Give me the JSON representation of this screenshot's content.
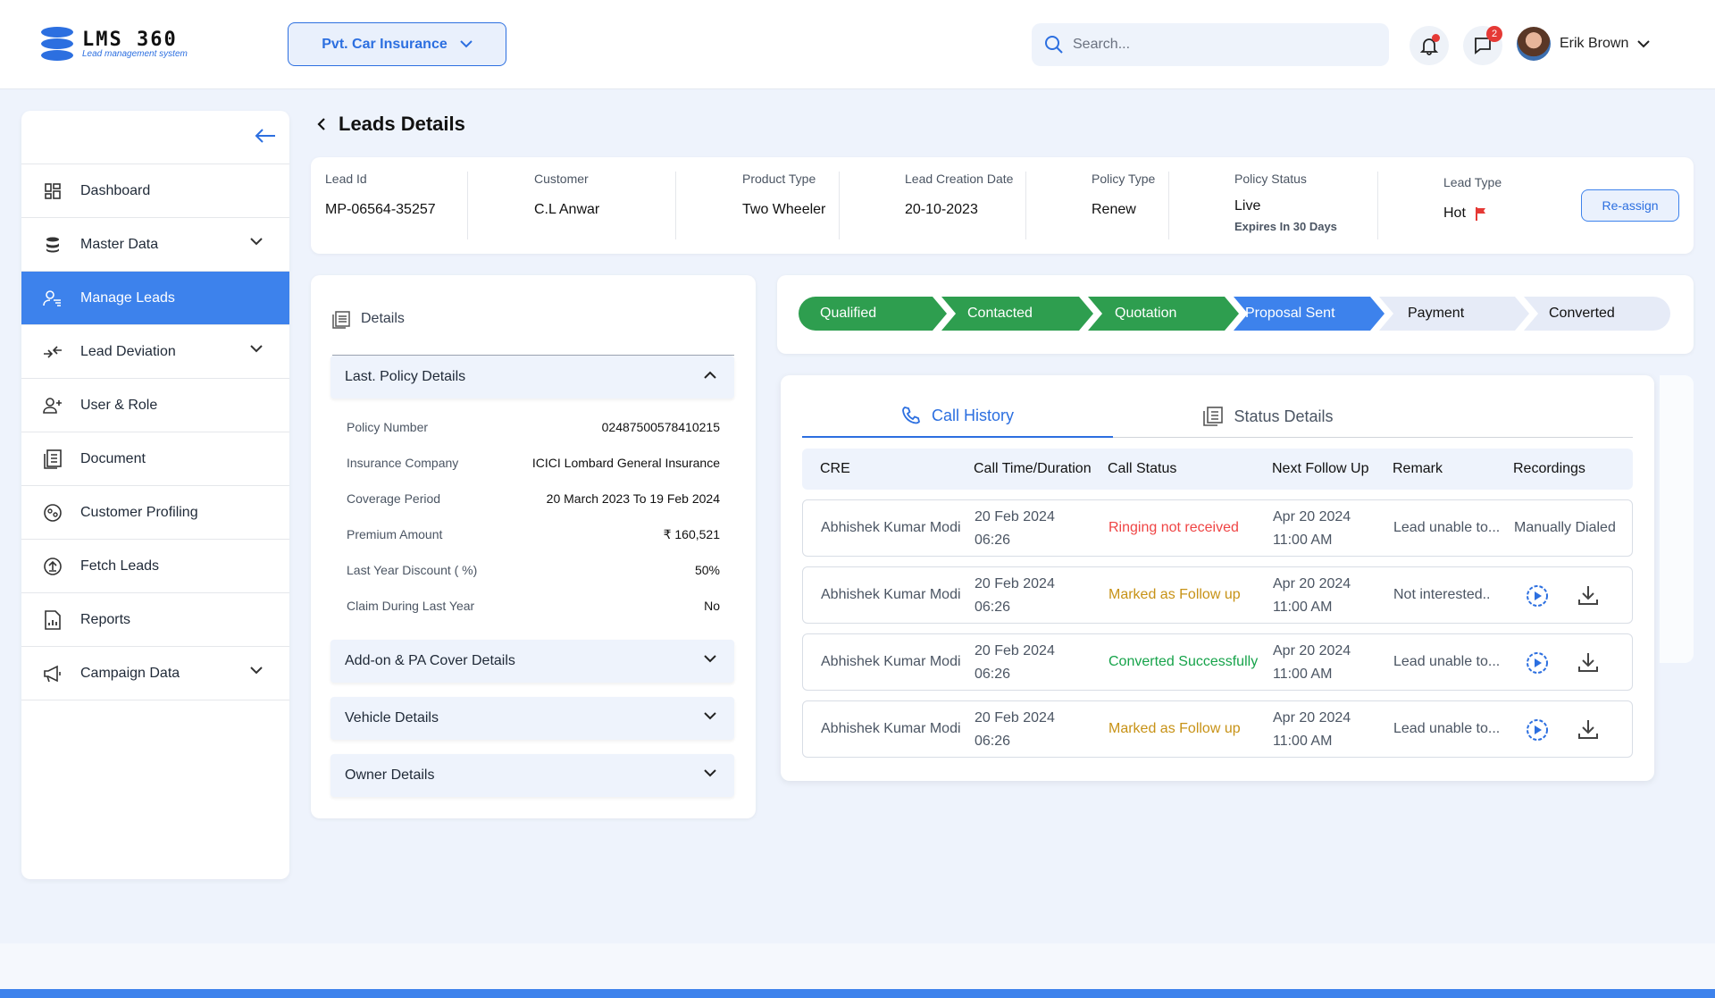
{
  "app": {
    "name": "LMS 360",
    "tagline": "Lead management system"
  },
  "header": {
    "product_select": "Pvt. Car Insurance",
    "search_placeholder": "Search...",
    "notifications_dot": true,
    "messages_count": "2",
    "user_name": "Erik Brown"
  },
  "sidebar": {
    "items": [
      {
        "label": "Dashboard",
        "icon": "dashboard-icon",
        "has_children": false,
        "active": false
      },
      {
        "label": "Master Data",
        "icon": "database-icon",
        "has_children": true,
        "active": false
      },
      {
        "label": "Manage Leads",
        "icon": "user-manage-icon",
        "has_children": false,
        "active": true
      },
      {
        "label": "Lead Deviation",
        "icon": "deviation-icon",
        "has_children": true,
        "active": false
      },
      {
        "label": "User & Role",
        "icon": "user-add-icon",
        "has_children": false,
        "active": false
      },
      {
        "label": "Document",
        "icon": "document-icon",
        "has_children": false,
        "active": false
      },
      {
        "label": "Customer Profiling",
        "icon": "profile-icon",
        "has_children": false,
        "active": false
      },
      {
        "label": "Fetch Leads",
        "icon": "fetch-icon",
        "has_children": false,
        "active": false
      },
      {
        "label": "Reports",
        "icon": "report-icon",
        "has_children": false,
        "active": false
      },
      {
        "label": "Campaign Data",
        "icon": "megaphone-icon",
        "has_children": true,
        "active": false
      }
    ]
  },
  "page": {
    "title": "Leads Details"
  },
  "lead_info": {
    "lead_id": {
      "label": "Lead Id",
      "value": "MP-06564-35257"
    },
    "customer": {
      "label": "Customer",
      "value": "C.L Anwar"
    },
    "product_type": {
      "label": "Product Type",
      "value": "Two Wheeler"
    },
    "creation_date": {
      "label": "Lead Creation Date",
      "value": "20-10-2023"
    },
    "policy_type": {
      "label": "Policy Type",
      "value": "Renew"
    },
    "policy_status": {
      "label": "Policy Status",
      "value": "Live",
      "sub": "Expires In 30 Days"
    },
    "lead_type": {
      "label": "Lead Type",
      "value": "Hot"
    },
    "reassign_label": "Re-assign"
  },
  "details": {
    "title": "Details",
    "sections": [
      {
        "label": "Last. Policy Details",
        "expanded": true
      },
      {
        "label": "Add-on & PA Cover Details",
        "expanded": false
      },
      {
        "label": "Vehicle Details",
        "expanded": false
      },
      {
        "label": "Owner Details",
        "expanded": false
      }
    ],
    "policy_rows": [
      {
        "key": "Policy Number",
        "value": "02487500578410215"
      },
      {
        "key": "Insurance Company",
        "value": "ICICI Lombard General Insurance"
      },
      {
        "key": "Coverage Period",
        "value": "20 March 2023 To 19 Feb 2024"
      },
      {
        "key": "Premium Amount",
        "value": "₹ 160,521"
      },
      {
        "key": "Last Year Discount ( %)",
        "value": "50%"
      },
      {
        "key": "Claim During Last Year",
        "value": "No"
      }
    ]
  },
  "stages": [
    {
      "label": "Qualified",
      "state": "done"
    },
    {
      "label": "Contacted",
      "state": "done"
    },
    {
      "label": "Quotation",
      "state": "done"
    },
    {
      "label": "Proposal Sent",
      "state": "current"
    },
    {
      "label": "Payment",
      "state": "pending"
    },
    {
      "label": "Converted",
      "state": "pending"
    }
  ],
  "history": {
    "tabs": [
      {
        "label": "Call History",
        "active": true
      },
      {
        "label": "Status Details",
        "active": false
      }
    ],
    "columns": [
      "CRE",
      "Call Time/Duration",
      "Call Status",
      "Next Follow Up",
      "Remark",
      "Recordings"
    ],
    "rows": [
      {
        "cre": "Abhishek Kumar Modi",
        "date": "20 Feb 2024",
        "time": "06:26",
        "status": "Ringing not received",
        "status_tone": "red",
        "follow_date": "Apr 20 2024",
        "follow_time": "11:00 AM",
        "remark": "Lead unable to...",
        "recording": "Manually Dialed"
      },
      {
        "cre": "Abhishek Kumar Modi",
        "date": "20 Feb 2024",
        "time": "06:26",
        "status": "Marked as Follow up",
        "status_tone": "amber",
        "follow_date": "Apr 20 2024",
        "follow_time": "11:00 AM",
        "remark": "Not interested..",
        "recording": ""
      },
      {
        "cre": "Abhishek Kumar Modi",
        "date": "20 Feb 2024",
        "time": "06:26",
        "status": "Converted Successfully",
        "status_tone": "green",
        "follow_date": "Apr 20 2024",
        "follow_time": "11:00 AM",
        "remark": "Lead unable to...",
        "recording": ""
      },
      {
        "cre": "Abhishek Kumar Modi",
        "date": "20 Feb 2024",
        "time": "06:26",
        "status": "Marked as Follow up",
        "status_tone": "amber",
        "follow_date": "Apr 20 2024",
        "follow_time": "11:00 AM",
        "remark": "Lead unable to...",
        "recording": ""
      }
    ]
  },
  "colors": {
    "primary": "#3d82ec",
    "stage_done": "#2e9e4f",
    "stage_current": "#3d82ec",
    "stage_pending": "#e6ebf7"
  }
}
